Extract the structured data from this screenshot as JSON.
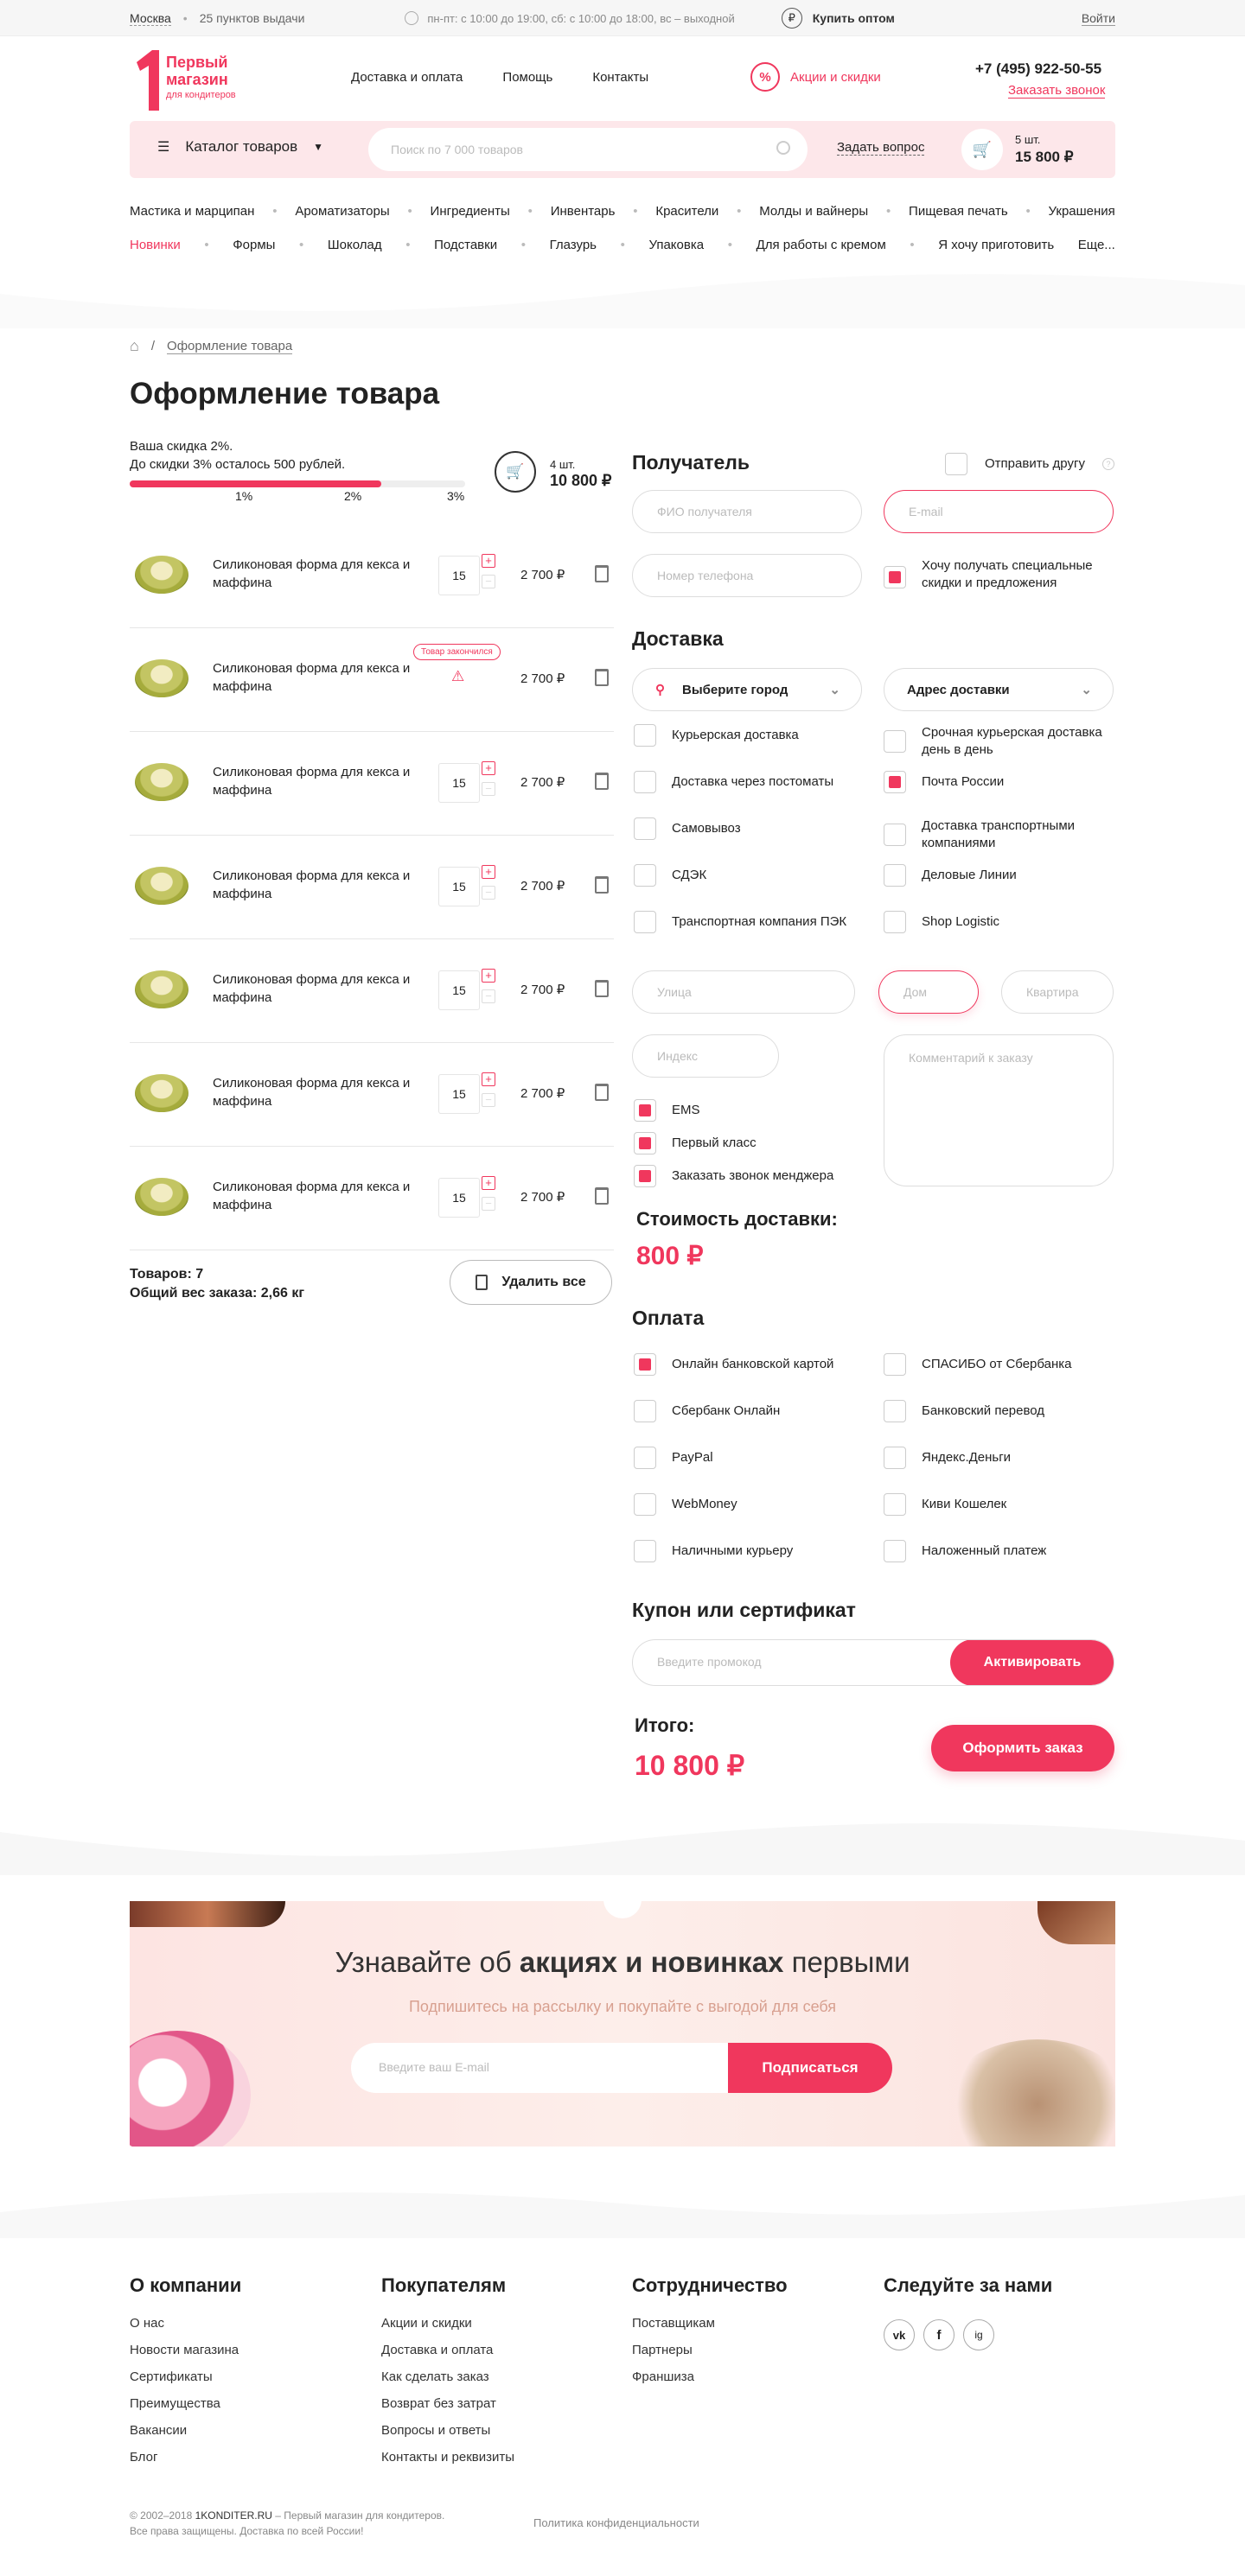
{
  "topbar": {
    "city": "Москва",
    "points": "25 пунктов выдачи",
    "hours": "пн-пт: с 10:00 до 19:00, сб: с 10:00 до 18:00, вс – выходной",
    "wholesale": "Купить оптом",
    "login": "Войти"
  },
  "header": {
    "logo_line1": "Первый",
    "logo_line2": "магазин",
    "logo_line3": "для кондитеров",
    "nav": [
      "Доставка и оплата",
      "Помощь",
      "Контакты"
    ],
    "promo": "Акции и скидки",
    "phone": "+7 (495) 922-50-55",
    "callback": "Заказать звонок"
  },
  "searchbar": {
    "catalog": "Каталог товаров",
    "placeholder": "Поиск по 7 000 товаров",
    "ask": "Задать вопрос",
    "cart_count": "5 шт.",
    "cart_sum": "15 800 ₽"
  },
  "categories_row1": [
    "Мастика и марципан",
    "Ароматизаторы",
    "Ингредиенты",
    "Инвентарь",
    "Красители",
    "Молды и вайнеры",
    "Пищевая печать",
    "Украшения"
  ],
  "categories_row2": [
    "Новинки",
    "Формы",
    "Шоколад",
    "Подставки",
    "Глазурь",
    "Упаковка",
    "Для работы с кремом",
    "Я хочу приготовить",
    "Еще..."
  ],
  "breadcrumb": {
    "current": "Оформление товара"
  },
  "page_title": "Оформление товара",
  "discount": {
    "line1": "Ваша скидка 2%.",
    "line2": "До скидки 3% осталось 500 рублей.",
    "progress": 0.75,
    "marks": [
      "1%",
      "2%",
      "3%"
    ],
    "count": "4 шт.",
    "sum": "10 800 ₽"
  },
  "products": [
    {
      "name": "Силиконовая форма для кекса и маффина",
      "qty": "15",
      "price": "2 700 ₽",
      "out": false
    },
    {
      "name": "Силиконовая форма для кекса и маффина",
      "qty": "",
      "price": "2 700 ₽",
      "out": true
    },
    {
      "name": "Силиконовая форма для кекса и маффина",
      "qty": "15",
      "price": "2 700 ₽",
      "out": false
    },
    {
      "name": "Силиконовая форма для кекса и маффина",
      "qty": "15",
      "price": "2 700 ₽",
      "out": false
    },
    {
      "name": "Силиконовая форма для кекса и маффина",
      "qty": "15",
      "price": "2 700 ₽",
      "out": false
    },
    {
      "name": "Силиконовая форма для кекса и маффина",
      "qty": "15",
      "price": "2 700 ₽",
      "out": false
    },
    {
      "name": "Силиконовая форма для кекса и маффина",
      "qty": "15",
      "price": "2 700 ₽",
      "out": false
    }
  ],
  "out_of_stock": "Товар закончился",
  "summary": {
    "items": "Товаров: 7",
    "weight": "Общий вес заказа: 2,66 кг",
    "delete_all": "Удалить все"
  },
  "recipient": {
    "title": "Получатель",
    "send_friend": "Отправить другу",
    "name_ph": "ФИО получателя",
    "email_ph": "E-mail",
    "phone_ph": "Номер телефона",
    "promo_opt": "Хочу получать специальные скидки и предложения"
  },
  "delivery": {
    "title": "Доставка",
    "city": "Выберите город",
    "address": "Адрес доставки",
    "options_left": [
      {
        "label": "Курьерская доставка",
        "on": false
      },
      {
        "label": "Доставка через постоматы",
        "on": false
      },
      {
        "label": "Самовывоз",
        "on": false
      },
      {
        "label": "СДЭК",
        "on": false
      },
      {
        "label": "Транспортная компания ПЭК",
        "on": false
      }
    ],
    "options_right": [
      {
        "label": "Срочная курьерская доставка день в день",
        "on": false
      },
      {
        "label": "Почта России",
        "on": true
      },
      {
        "label": "Доставка транспортными компаниями",
        "on": false
      },
      {
        "label": "Деловые Линии",
        "on": false
      },
      {
        "label": "Shop Logistic",
        "on": false
      }
    ],
    "street_ph": "Улица",
    "house_ph": "Дом",
    "flat_ph": "Квартира",
    "index_ph": "Индекс",
    "comment_ph": "Комментарий к заказу",
    "post_options": [
      "EMS",
      "Первый класс",
      "Заказать звонок менджера"
    ],
    "cost_label": "Стоимость доставки:",
    "cost": "800 ₽"
  },
  "payment": {
    "title": "Оплата",
    "left": [
      {
        "label": "Онлайн банковской картой",
        "on": true
      },
      {
        "label": "Сбербанк Онлайн",
        "on": false
      },
      {
        "label": "PayPal",
        "on": false
      },
      {
        "label": "WebMoney",
        "on": false
      },
      {
        "label": "Наличными курьеру",
        "on": false
      }
    ],
    "right": [
      {
        "label": "СПАСИБО от Сбербанка",
        "on": false
      },
      {
        "label": "Банковский перевод",
        "on": false
      },
      {
        "label": "Яндекс.Деньги",
        "on": false
      },
      {
        "label": "Киви Кошелек",
        "on": false
      },
      {
        "label": "Наложенный платеж",
        "on": false
      }
    ]
  },
  "coupon": {
    "title": "Купон или сертификат",
    "placeholder": "Введите промокод",
    "button": "Активировать"
  },
  "total": {
    "label": "Итого:",
    "sum": "10 800 ₽",
    "button": "Оформить заказ"
  },
  "subscribe": {
    "title_pre": "Узнавайте об ",
    "title_bold": "акциях и новинках",
    "title_post": " первыми",
    "subtitle": "Подпишитесь на рассылку и покупайте с выгодой для себя",
    "placeholder": "Введите ваш E-mail",
    "button": "Подписаться"
  },
  "footer": {
    "cols": [
      {
        "title": "О компании",
        "items": [
          "О нас",
          "Новости магазина",
          "Сертификаты",
          "Преимущества",
          "Вакансии",
          "Блог"
        ]
      },
      {
        "title": "Покупателям",
        "items": [
          "Акции и скидки",
          "Доставка и оплата",
          "Как сделать заказ",
          "Возврат без затрат",
          "Вопросы и ответы",
          "Контакты и реквизиты"
        ]
      },
      {
        "title": "Сотрудничество",
        "items": [
          "Поставщикам",
          "Партнеры",
          "Франшиза"
        ]
      },
      {
        "title": "Следуйте за нами",
        "items": []
      }
    ],
    "social": [
      "vk",
      "f",
      "ig"
    ],
    "copy1_pre": "© 2002–2018 ",
    "copy1_brand": "1KONDITER.RU",
    "copy1_post": " – Первый магазин для кондитеров.",
    "copy2": "Все права защищены. Доставка по всей России!",
    "privacy": "Политика конфиденциальности"
  },
  "colors": {
    "accent": "#f0375d",
    "pink_bg": "#fde7ea"
  }
}
